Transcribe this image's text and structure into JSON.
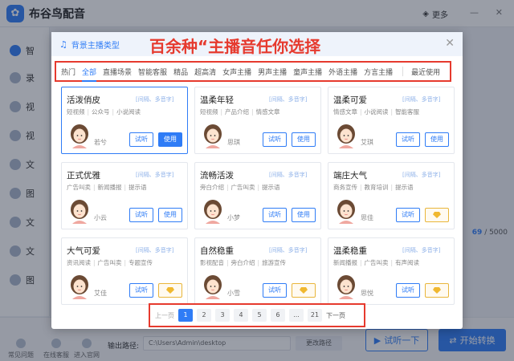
{
  "app": {
    "title": "布谷鸟配音",
    "more_label": "更多",
    "sidebar_items": [
      {
        "label": "智"
      },
      {
        "label": "录"
      },
      {
        "label": "视"
      },
      {
        "label": "视"
      },
      {
        "label": "文"
      },
      {
        "label": "图"
      },
      {
        "label": "文"
      },
      {
        "label": "文"
      },
      {
        "label": "图"
      }
    ],
    "counter": "69",
    "counter_total": "/ 5000",
    "bottom_tools": [
      {
        "label": "常见问题"
      },
      {
        "label": "在线客服"
      },
      {
        "label": "进入官网"
      }
    ],
    "output_label": "输出路径:",
    "output_path": "C:\\Users\\Admin\\desktop",
    "change_path": "更改路径",
    "listen_btn": "试听一下",
    "convert_btn": "开始转换"
  },
  "modal": {
    "title": "背景主播类型",
    "headline": "百余种“主播音任你选择",
    "tabs": [
      {
        "label": "热门"
      },
      {
        "label": "全部"
      },
      {
        "label": "直播场景"
      },
      {
        "label": "智能客服"
      },
      {
        "label": "精品"
      },
      {
        "label": "超高清"
      },
      {
        "label": "女声主播"
      },
      {
        "label": "男声主播"
      },
      {
        "label": "童声主播"
      },
      {
        "label": "外语主播"
      },
      {
        "label": "方言主播"
      }
    ],
    "recent_tab": "最近使用",
    "active_tab": "全部",
    "card_tags": "[间隔、多音字]",
    "try_label": "试听",
    "use_label": "使用",
    "cards": [
      {
        "name": "活泼俏皮",
        "desc": [
          "短视频",
          "公众号",
          "小说阅读"
        ],
        "voice": "若兮",
        "gender": "female",
        "vip": false,
        "selected": true
      },
      {
        "name": "温柔年轻",
        "desc": [
          "短视频",
          "产品介绍",
          "情感文章"
        ],
        "voice": "思琪",
        "gender": "female",
        "vip": false,
        "selected": false
      },
      {
        "name": "温柔可爱",
        "desc": [
          "情感文章",
          "小说阅读",
          "智能客服"
        ],
        "voice": "艾琪",
        "gender": "female",
        "vip": false,
        "selected": false
      },
      {
        "name": "正式优雅",
        "desc": [
          "广告叫卖",
          "新闻播报",
          "提示语"
        ],
        "voice": "小云",
        "gender": "female",
        "vip": false,
        "selected": false
      },
      {
        "name": "流畅活泼",
        "desc": [
          "旁白介绍",
          "广告叫卖",
          "提示语"
        ],
        "voice": "小梦",
        "gender": "female",
        "vip": false,
        "selected": false
      },
      {
        "name": "端庄大气",
        "desc": [
          "商务宣传",
          "教育培训",
          "提示语"
        ],
        "voice": "思佳",
        "gender": "female",
        "vip": true,
        "selected": false
      },
      {
        "name": "大气可爱",
        "desc": [
          "资讯阅读",
          "广告叫卖",
          "专题宣传"
        ],
        "voice": "艾佳",
        "gender": "female",
        "vip": true,
        "selected": false
      },
      {
        "name": "自然稳重",
        "desc": [
          "影视配音",
          "旁白介绍",
          "旅游宣传"
        ],
        "voice": "小雪",
        "gender": "female",
        "vip": true,
        "selected": false
      },
      {
        "name": "温柔稳重",
        "desc": [
          "新闻播报",
          "广告叫卖",
          "有声阅读"
        ],
        "voice": "思悦",
        "gender": "female",
        "vip": true,
        "selected": false
      }
    ]
  },
  "pagination": {
    "prev": "上一页",
    "pages": [
      "1",
      "2",
      "3",
      "4",
      "5",
      "6",
      "...",
      "21"
    ],
    "current": "1",
    "next": "下一页"
  },
  "colors": {
    "accent": "#2f7cf6",
    "highlight_red": "#e63a2e",
    "vip_gold": "#f0b82f"
  }
}
